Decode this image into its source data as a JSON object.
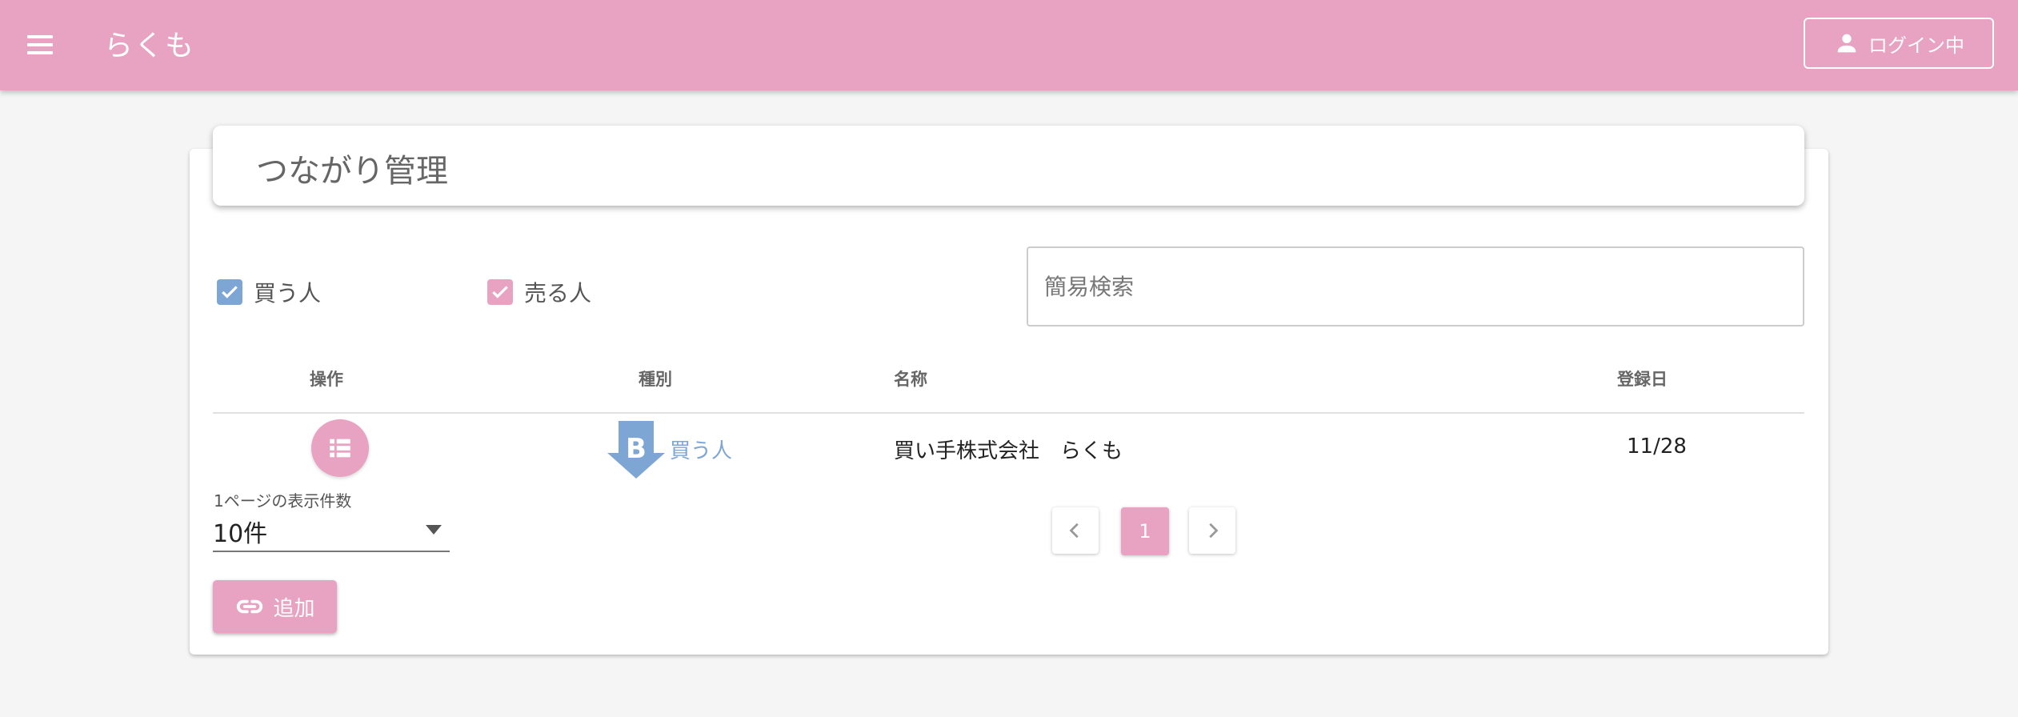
{
  "appbar": {
    "title": "らくも",
    "login_label": "ログイン中",
    "color": "#e8a2c2"
  },
  "page": {
    "title": "つながり管理"
  },
  "filters": {
    "buyer_label": "買う人",
    "buyer_checked": true,
    "buyer_color": "#7ea6d4",
    "seller_label": "売る人",
    "seller_checked": true,
    "seller_color": "#e8a2c2"
  },
  "search": {
    "placeholder": "簡易検索",
    "value": ""
  },
  "table": {
    "headers": {
      "operation": "操作",
      "type": "種別",
      "name": "名称",
      "registered": "登録日"
    },
    "rows": [
      {
        "operation_icon": "list-icon",
        "type_icon": "buyer-badge-icon",
        "type_badge_letter": "B",
        "type": "買う人",
        "name": "買い手株式会社　らくも",
        "registered": "11/28"
      }
    ]
  },
  "pagination": {
    "per_page_label": "1ページの表示件数",
    "per_page_value": "10件",
    "current_page": "1",
    "prev_icon": "chevron-left-icon",
    "next_icon": "chevron-right-icon"
  },
  "actions": {
    "add_label": "追加",
    "add_icon": "link-icon"
  },
  "icons": {
    "menu": "menu-icon",
    "account": "account-icon"
  }
}
